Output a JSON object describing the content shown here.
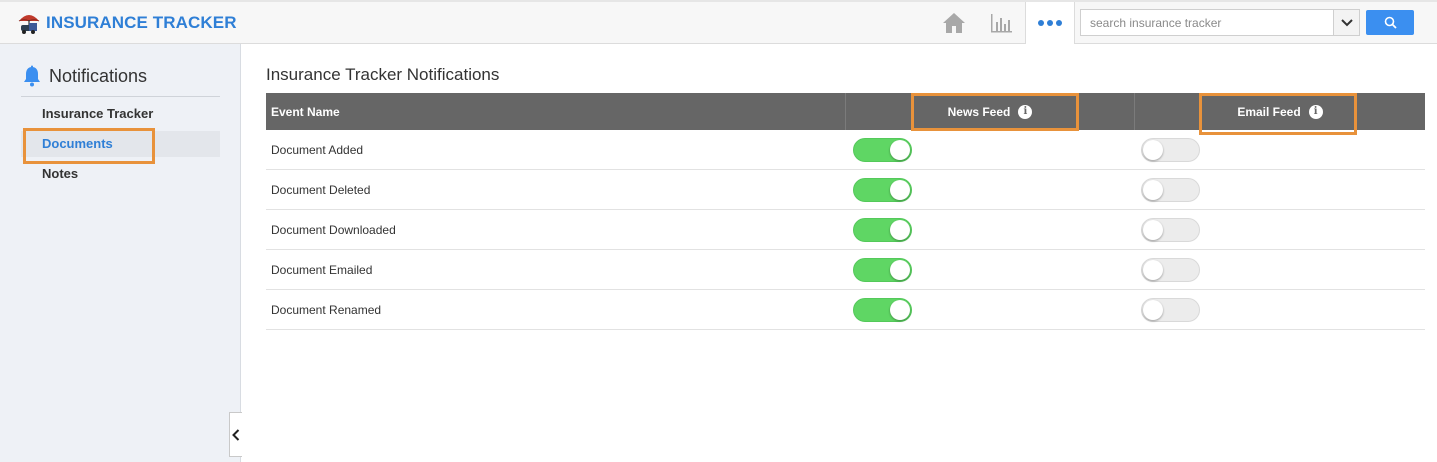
{
  "header": {
    "app_title": "INSURANCE TRACKER",
    "search": {
      "placeholder": "search insurance tracker",
      "value": ""
    },
    "accent_color": "#2f7fd6"
  },
  "sidebar": {
    "title": "Notifications",
    "items": [
      {
        "label": "Insurance Tracker",
        "active": false
      },
      {
        "label": "Documents",
        "active": true
      },
      {
        "label": "Notes",
        "active": false
      }
    ]
  },
  "main": {
    "title": "Insurance Tracker Notifications",
    "columns": {
      "event": "Event Name",
      "news": "News Feed",
      "email": "Email Feed"
    },
    "rows": [
      {
        "event": "Document Added",
        "news_feed": true,
        "email_feed": false
      },
      {
        "event": "Document Deleted",
        "news_feed": true,
        "email_feed": false
      },
      {
        "event": "Document Downloaded",
        "news_feed": true,
        "email_feed": false
      },
      {
        "event": "Document Emailed",
        "news_feed": true,
        "email_feed": false
      },
      {
        "event": "Document Renamed",
        "news_feed": true,
        "email_feed": false
      }
    ]
  },
  "icons": {
    "logo": "insurance-umbrella-icon",
    "home": "home-icon",
    "chart": "bar-chart-icon",
    "more": "more-dots-icon",
    "search": "search-icon",
    "bell": "bell-icon",
    "info": "info-icon"
  },
  "highlight_color": "#e8923b"
}
